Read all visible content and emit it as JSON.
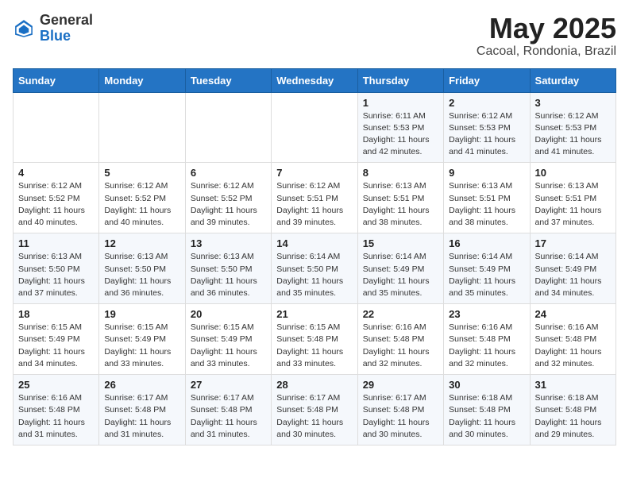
{
  "logo": {
    "general": "General",
    "blue": "Blue"
  },
  "title": {
    "month_year": "May 2025",
    "location": "Cacoal, Rondonia, Brazil"
  },
  "headers": [
    "Sunday",
    "Monday",
    "Tuesday",
    "Wednesday",
    "Thursday",
    "Friday",
    "Saturday"
  ],
  "weeks": [
    [
      {
        "day": "",
        "detail": ""
      },
      {
        "day": "",
        "detail": ""
      },
      {
        "day": "",
        "detail": ""
      },
      {
        "day": "",
        "detail": ""
      },
      {
        "day": "1",
        "detail": "Sunrise: 6:11 AM\nSunset: 5:53 PM\nDaylight: 11 hours\nand 42 minutes."
      },
      {
        "day": "2",
        "detail": "Sunrise: 6:12 AM\nSunset: 5:53 PM\nDaylight: 11 hours\nand 41 minutes."
      },
      {
        "day": "3",
        "detail": "Sunrise: 6:12 AM\nSunset: 5:53 PM\nDaylight: 11 hours\nand 41 minutes."
      }
    ],
    [
      {
        "day": "4",
        "detail": "Sunrise: 6:12 AM\nSunset: 5:52 PM\nDaylight: 11 hours\nand 40 minutes."
      },
      {
        "day": "5",
        "detail": "Sunrise: 6:12 AM\nSunset: 5:52 PM\nDaylight: 11 hours\nand 40 minutes."
      },
      {
        "day": "6",
        "detail": "Sunrise: 6:12 AM\nSunset: 5:52 PM\nDaylight: 11 hours\nand 39 minutes."
      },
      {
        "day": "7",
        "detail": "Sunrise: 6:12 AM\nSunset: 5:51 PM\nDaylight: 11 hours\nand 39 minutes."
      },
      {
        "day": "8",
        "detail": "Sunrise: 6:13 AM\nSunset: 5:51 PM\nDaylight: 11 hours\nand 38 minutes."
      },
      {
        "day": "9",
        "detail": "Sunrise: 6:13 AM\nSunset: 5:51 PM\nDaylight: 11 hours\nand 38 minutes."
      },
      {
        "day": "10",
        "detail": "Sunrise: 6:13 AM\nSunset: 5:51 PM\nDaylight: 11 hours\nand 37 minutes."
      }
    ],
    [
      {
        "day": "11",
        "detail": "Sunrise: 6:13 AM\nSunset: 5:50 PM\nDaylight: 11 hours\nand 37 minutes."
      },
      {
        "day": "12",
        "detail": "Sunrise: 6:13 AM\nSunset: 5:50 PM\nDaylight: 11 hours\nand 36 minutes."
      },
      {
        "day": "13",
        "detail": "Sunrise: 6:13 AM\nSunset: 5:50 PM\nDaylight: 11 hours\nand 36 minutes."
      },
      {
        "day": "14",
        "detail": "Sunrise: 6:14 AM\nSunset: 5:50 PM\nDaylight: 11 hours\nand 35 minutes."
      },
      {
        "day": "15",
        "detail": "Sunrise: 6:14 AM\nSunset: 5:49 PM\nDaylight: 11 hours\nand 35 minutes."
      },
      {
        "day": "16",
        "detail": "Sunrise: 6:14 AM\nSunset: 5:49 PM\nDaylight: 11 hours\nand 35 minutes."
      },
      {
        "day": "17",
        "detail": "Sunrise: 6:14 AM\nSunset: 5:49 PM\nDaylight: 11 hours\nand 34 minutes."
      }
    ],
    [
      {
        "day": "18",
        "detail": "Sunrise: 6:15 AM\nSunset: 5:49 PM\nDaylight: 11 hours\nand 34 minutes."
      },
      {
        "day": "19",
        "detail": "Sunrise: 6:15 AM\nSunset: 5:49 PM\nDaylight: 11 hours\nand 33 minutes."
      },
      {
        "day": "20",
        "detail": "Sunrise: 6:15 AM\nSunset: 5:49 PM\nDaylight: 11 hours\nand 33 minutes."
      },
      {
        "day": "21",
        "detail": "Sunrise: 6:15 AM\nSunset: 5:48 PM\nDaylight: 11 hours\nand 33 minutes."
      },
      {
        "day": "22",
        "detail": "Sunrise: 6:16 AM\nSunset: 5:48 PM\nDaylight: 11 hours\nand 32 minutes."
      },
      {
        "day": "23",
        "detail": "Sunrise: 6:16 AM\nSunset: 5:48 PM\nDaylight: 11 hours\nand 32 minutes."
      },
      {
        "day": "24",
        "detail": "Sunrise: 6:16 AM\nSunset: 5:48 PM\nDaylight: 11 hours\nand 32 minutes."
      }
    ],
    [
      {
        "day": "25",
        "detail": "Sunrise: 6:16 AM\nSunset: 5:48 PM\nDaylight: 11 hours\nand 31 minutes."
      },
      {
        "day": "26",
        "detail": "Sunrise: 6:17 AM\nSunset: 5:48 PM\nDaylight: 11 hours\nand 31 minutes."
      },
      {
        "day": "27",
        "detail": "Sunrise: 6:17 AM\nSunset: 5:48 PM\nDaylight: 11 hours\nand 31 minutes."
      },
      {
        "day": "28",
        "detail": "Sunrise: 6:17 AM\nSunset: 5:48 PM\nDaylight: 11 hours\nand 30 minutes."
      },
      {
        "day": "29",
        "detail": "Sunrise: 6:17 AM\nSunset: 5:48 PM\nDaylight: 11 hours\nand 30 minutes."
      },
      {
        "day": "30",
        "detail": "Sunrise: 6:18 AM\nSunset: 5:48 PM\nDaylight: 11 hours\nand 30 minutes."
      },
      {
        "day": "31",
        "detail": "Sunrise: 6:18 AM\nSunset: 5:48 PM\nDaylight: 11 hours\nand 29 minutes."
      }
    ]
  ]
}
